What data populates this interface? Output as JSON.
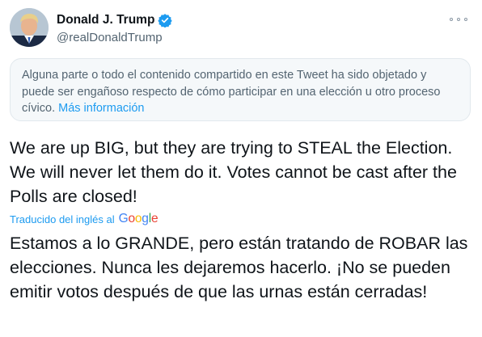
{
  "author": {
    "display_name": "Donald J. Trump",
    "handle": "@realDonaldTrump",
    "verified": true,
    "avatar_icon": "profile-photo"
  },
  "notice": {
    "text": "Alguna parte o todo el contenido compartido en este Tweet ha sido objetado y puede ser engañoso respecto de cómo participar en una elección u otro proceso cívico.",
    "link_label": "Más información"
  },
  "tweet": {
    "text": "We are up BIG, but they are trying to STEAL the Election. We will never let them do it. Votes cannot be cast after the Polls are closed!",
    "translated_by_label": "Traducido del inglés al",
    "translation_provider": "Google",
    "translation": "Estamos a lo GRANDE, pero están tratando de ROBAR las elecciones. Nunca les dejaremos hacerlo. ¡No se pueden emitir votos después de que las urnas están cerradas!"
  },
  "colors": {
    "accent": "#1d9bf0",
    "secondary_text": "#536471",
    "primary_text": "#0f1419",
    "notice_bg": "#f5f8fa"
  },
  "icons": {
    "verified": "verified-badge-icon",
    "more": "more-options-icon"
  }
}
